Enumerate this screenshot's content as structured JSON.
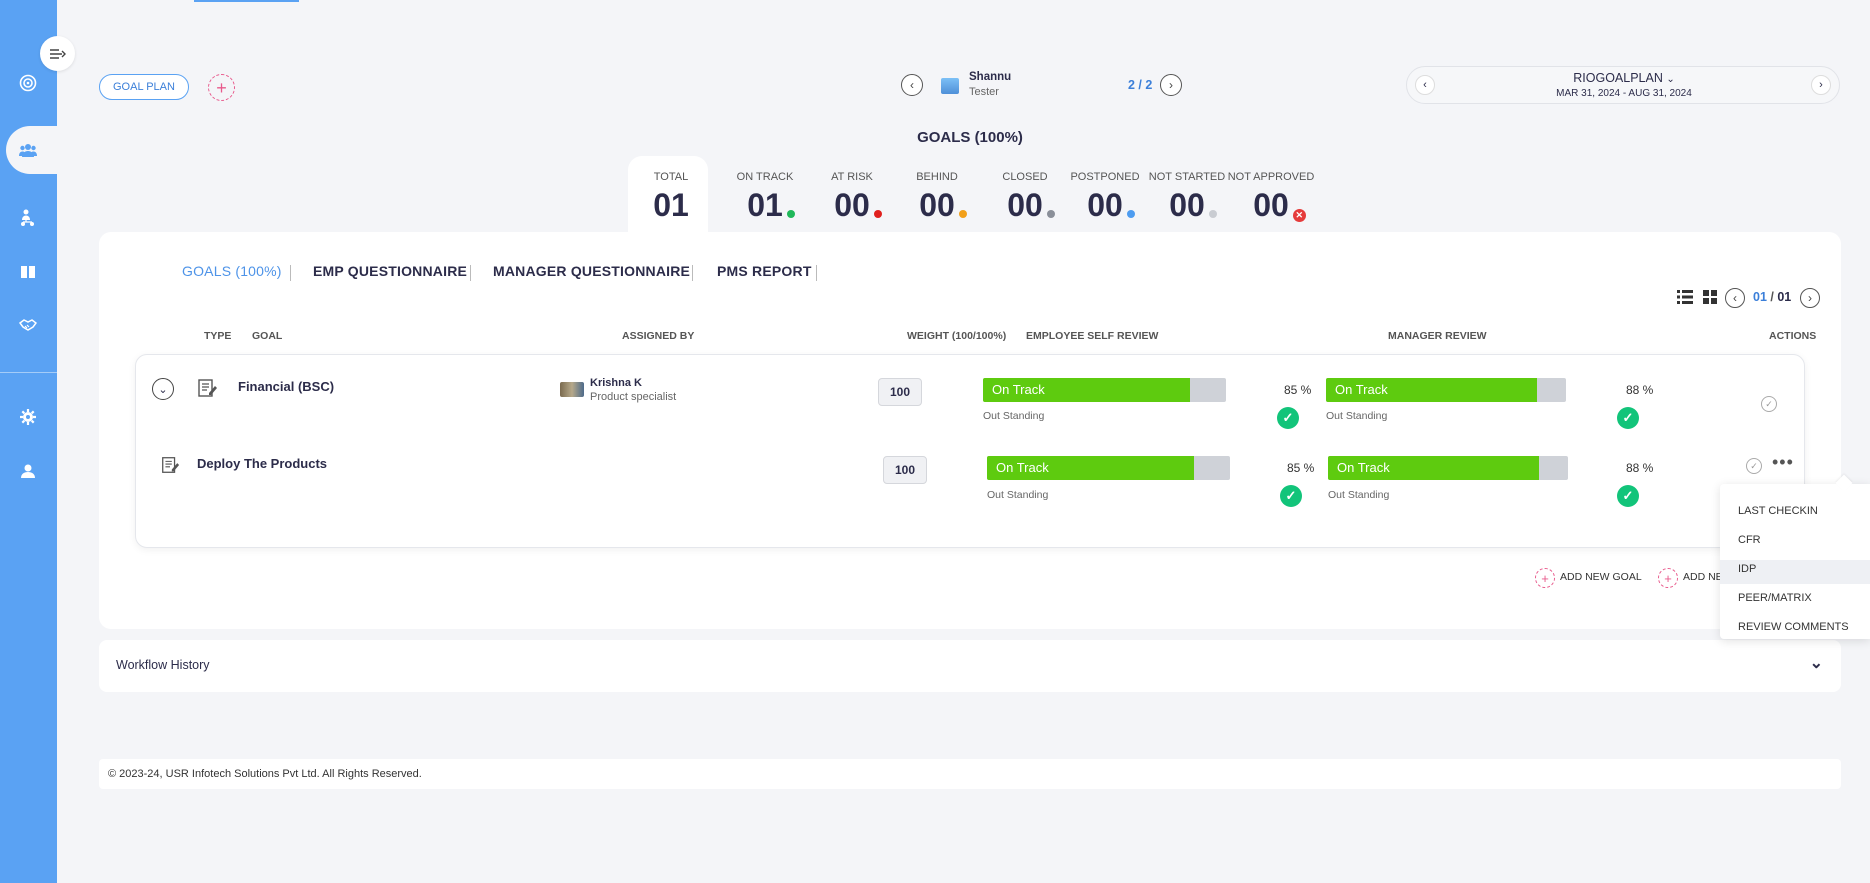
{
  "header": {
    "goal_plan_label": "GOAL PLAN",
    "employee": {
      "name": "Shannu",
      "role": "Tester"
    },
    "pager": "2 / 2",
    "plan": {
      "name": "RIOGOALPLAN",
      "dates": "MAR 31, 2024 - AUG 31, 2024"
    }
  },
  "goals_title": "GOALS (100%)",
  "stats": [
    {
      "label": "TOTAL",
      "value": "01"
    },
    {
      "label": "ON TRACK",
      "value": "01",
      "color": "#1fb85a"
    },
    {
      "label": "AT RISK",
      "value": "00",
      "color": "#e0201e"
    },
    {
      "label": "BEHIND",
      "value": "00",
      "color": "#f2a01a"
    },
    {
      "label": "CLOSED",
      "value": "00",
      "color": "#8a8f99"
    },
    {
      "label": "POSTPONED",
      "value": "00",
      "color": "#4d9cf0"
    },
    {
      "label": "NOT STARTED",
      "value": "00",
      "color": "#c9ccd2"
    },
    {
      "label": "NOT APPROVED",
      "value": "00",
      "color": "#e53b3b"
    }
  ],
  "tabs": [
    "GOALS (100%)",
    "EMP QUESTIONNAIRE",
    "MANAGER QUESTIONNAIRE",
    "PMS REPORT"
  ],
  "table_pager": {
    "current": "01",
    "sep": "/",
    "total": "01"
  },
  "columns": [
    "TYPE",
    "GOAL",
    "ASSIGNED BY",
    "WEIGHT (100/100%)",
    "EMPLOYEE SELF REVIEW",
    "MANAGER REVIEW",
    "ACTIONS"
  ],
  "rows": [
    {
      "goal": "Financial (BSC)",
      "assigned_name": "Krishna K",
      "assigned_role": "Product specialist",
      "weight": "100",
      "self": {
        "status": "On Track",
        "progress": 85,
        "pct": "85 %",
        "rating": "Out Standing"
      },
      "manager": {
        "status": "On Track",
        "progress": 88,
        "pct": "88 %",
        "rating": "Out Standing"
      }
    },
    {
      "goal": "Deploy The Products",
      "weight": "100",
      "self": {
        "status": "On Track",
        "progress": 85,
        "pct": "85 %",
        "rating": "Out Standing"
      },
      "manager": {
        "status": "On Track",
        "progress": 88,
        "pct": "88 %",
        "rating": "Out Standing"
      }
    }
  ],
  "add_goal_label": "ADD NEW GOAL",
  "add_goal_label_2": "ADD NE",
  "action_menu": [
    "LAST CHECKIN",
    "CFR",
    "IDP",
    "PEER/MATRIX",
    "REVIEW COMMENTS"
  ],
  "workflow_label": "Workflow History",
  "footer": "© 2023-24, USR Infotech Solutions Pvt Ltd. All Rights Reserved."
}
